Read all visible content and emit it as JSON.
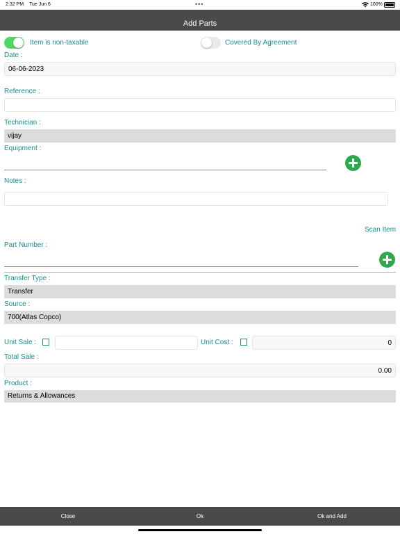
{
  "status_bar": {
    "time": "2:32 PM",
    "date": "Tue Jun 6",
    "battery": "100%"
  },
  "nav": {
    "title": "Add Parts"
  },
  "toggles": {
    "non_taxable_label": "Item is non-taxable",
    "non_taxable_on": true,
    "agreement_label": "Covered By Agreement",
    "agreement_on": false
  },
  "form": {
    "date_label": "Date :",
    "date_value": "06-06-2023",
    "reference_label": "Reference :",
    "reference_value": "",
    "technician_label": "Technician :",
    "technician_value": "vijay",
    "equipment_label": "Equipment :",
    "equipment_value": "",
    "notes_label": "Notes :",
    "notes_value": "",
    "scan_item": "Scan Item",
    "part_number_label": "Part Number :",
    "part_number_value": "",
    "transfer_type_label": "Transfer Type :",
    "transfer_type_value": "Transfer",
    "source_label": "Source :",
    "source_value": "700(Atlas Copco)",
    "unit_sale_label": "Unit Sale :",
    "unit_sale_value": "",
    "unit_cost_label": "Unit Cost :",
    "unit_cost_value": "0",
    "total_sale_label": "Total Sale :",
    "total_sale_value": "0.00",
    "product_label": "Product :",
    "product_value": "Returns & Allowances"
  },
  "bottom_bar": {
    "close": "Close",
    "ok": "Ok",
    "ok_and_add": "Ok and Add"
  },
  "colors": {
    "accent": "#168f8c",
    "nav_bg": "#4a4a4a",
    "toggle_on": "#4cd964",
    "add_button": "#2da84a"
  }
}
